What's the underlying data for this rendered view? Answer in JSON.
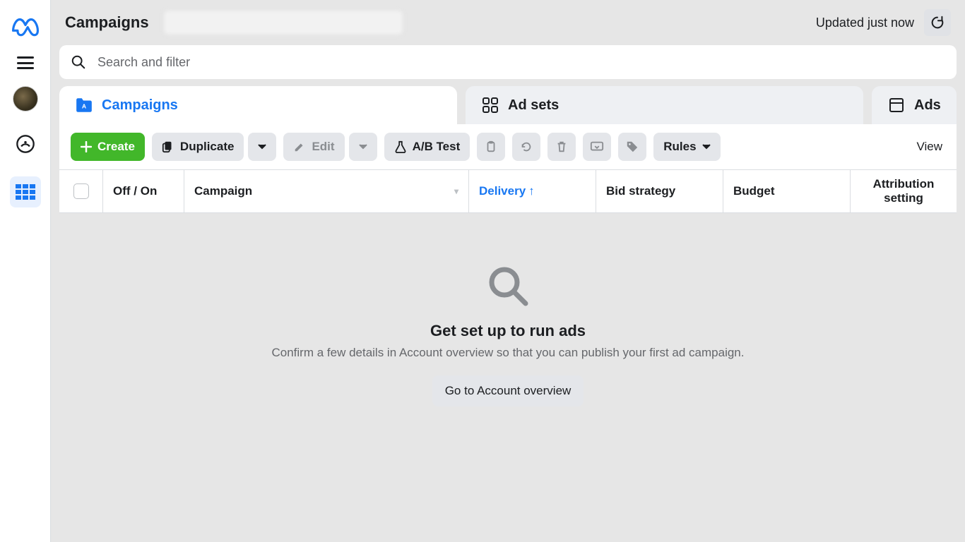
{
  "header": {
    "title": "Campaigns",
    "updated_text": "Updated just now"
  },
  "search": {
    "placeholder": "Search and filter"
  },
  "tabs": {
    "campaigns": "Campaigns",
    "adsets": "Ad sets",
    "ads": "Ads"
  },
  "toolbar": {
    "create": "Create",
    "duplicate": "Duplicate",
    "edit": "Edit",
    "abtest": "A/B Test",
    "rules": "Rules",
    "view": "View"
  },
  "columns": {
    "onoff": "Off / On",
    "campaign": "Campaign",
    "delivery": "Delivery",
    "bid": "Bid strategy",
    "budget": "Budget",
    "attr_line1": "Attribution",
    "attr_line2": "setting"
  },
  "empty": {
    "title": "Get set up to run ads",
    "subtitle": "Confirm a few details in Account overview so that you can publish your first ad campaign.",
    "button": "Go to Account overview"
  },
  "colors": {
    "primary": "#1877f2",
    "success": "#42b72a"
  }
}
